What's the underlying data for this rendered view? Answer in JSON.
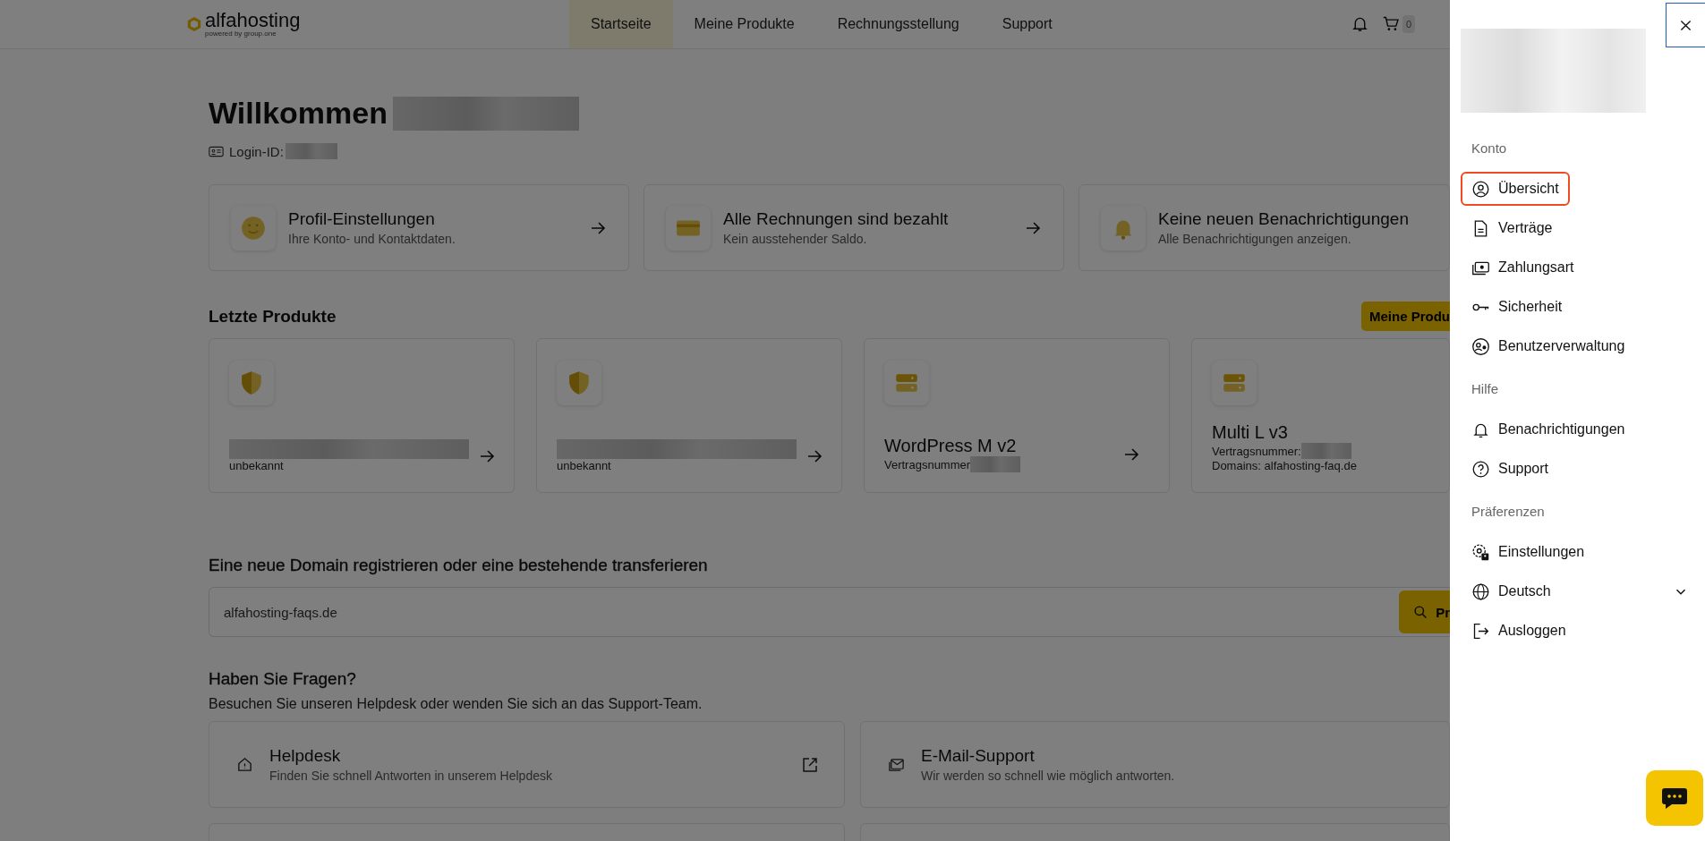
{
  "header": {
    "logo": "alfahosting",
    "tagline": "powered by group.one",
    "cart_count": "0",
    "nav": [
      {
        "label": "Startseite",
        "selected": true
      },
      {
        "label": "Meine Produkte",
        "selected": false
      },
      {
        "label": "Rechnungsstellung",
        "selected": false
      },
      {
        "label": "Support",
        "selected": false
      }
    ]
  },
  "welcome": {
    "title": "Willkommen",
    "name_blurred": true,
    "login_label": "Login-ID:",
    "login_blurred": true
  },
  "quick_cards": [
    {
      "kind": "profile",
      "title": "Profil-Einstellungen",
      "subtitle": "Ihre Konto- und Kontaktdaten.",
      "arrow": true
    },
    {
      "kind": "invoice",
      "title": "Alle Rechnungen sind bezahlt",
      "subtitle": "Kein ausstehender Saldo.",
      "arrow": true
    },
    {
      "kind": "bell",
      "title": "Keine neuen Benachrichtigungen",
      "subtitle": "Alle Benachrichtigungen anzeigen.",
      "arrow": false
    }
  ],
  "recent_products": {
    "title": "Letzte Produkte",
    "button": "Meine Produ",
    "items": [
      {
        "kind": "ssl",
        "name_blurred": true,
        "lines": [
          {
            "text": "unbekannt",
            "blurred": false
          }
        ],
        "arrow": true
      },
      {
        "kind": "ssl",
        "name_blurred": true,
        "lines": [
          {
            "text": "unbekannt",
            "blurred": false
          }
        ],
        "arrow": true
      },
      {
        "kind": "server",
        "name": "WordPress M v2",
        "lines": [
          {
            "text": "Vertragsnummer",
            "blurred": true
          }
        ],
        "arrow": true
      },
      {
        "kind": "server",
        "name": "Multi L v3",
        "lines": [
          {
            "text": "Vertragsnummer:",
            "blurred": true
          },
          {
            "text": "Domains: alfahosting-faq.de",
            "blurred": false
          }
        ],
        "arrow": false
      }
    ]
  },
  "domain": {
    "title": "Eine neue Domain registrieren oder eine bestehende transferieren",
    "value": "alfahosting-faqs.de",
    "button": "Pr"
  },
  "help": {
    "title": "Haben Sie Fragen?",
    "subtitle": "Besuchen Sie unseren Helpdesk oder wenden Sie sich an das Support-Team.",
    "cards": [
      {
        "kind": "helpdesk",
        "title": "Helpdesk",
        "subtitle": "Finden Sie schnell Antworten in unserem Helpdesk",
        "external": true
      },
      {
        "kind": "email",
        "title": "E-Mail-Support",
        "subtitle": "Wir werden so schnell wie möglich antworten.",
        "external": false
      },
      {
        "kind": "partial"
      },
      {
        "kind": "partial"
      }
    ]
  },
  "drawer": {
    "avatar_blurred": true,
    "sections": [
      {
        "title": "Konto",
        "items": [
          {
            "kind": "user",
            "label": "Übersicht",
            "selected": true
          },
          {
            "kind": "document",
            "label": "Verträge",
            "selected": false
          },
          {
            "kind": "payment",
            "label": "Zahlungsart",
            "selected": false
          },
          {
            "kind": "key",
            "label": "Sicherheit",
            "selected": false
          },
          {
            "kind": "users",
            "label": "Benutzerverwaltung",
            "selected": false
          }
        ]
      },
      {
        "title": "Hilfe",
        "items": [
          {
            "kind": "bell",
            "label": "Benachrichtigungen",
            "selected": false
          },
          {
            "kind": "question",
            "label": "Support",
            "selected": false
          }
        ]
      },
      {
        "title": "Präferenzen",
        "items": [
          {
            "kind": "settings",
            "label": "Einstellungen",
            "selected": false
          },
          {
            "kind": "globe",
            "label": "Deutsch",
            "selected": false,
            "dropdown": true
          },
          {
            "kind": "logout",
            "label": "Ausloggen",
            "selected": false
          }
        ]
      }
    ]
  }
}
